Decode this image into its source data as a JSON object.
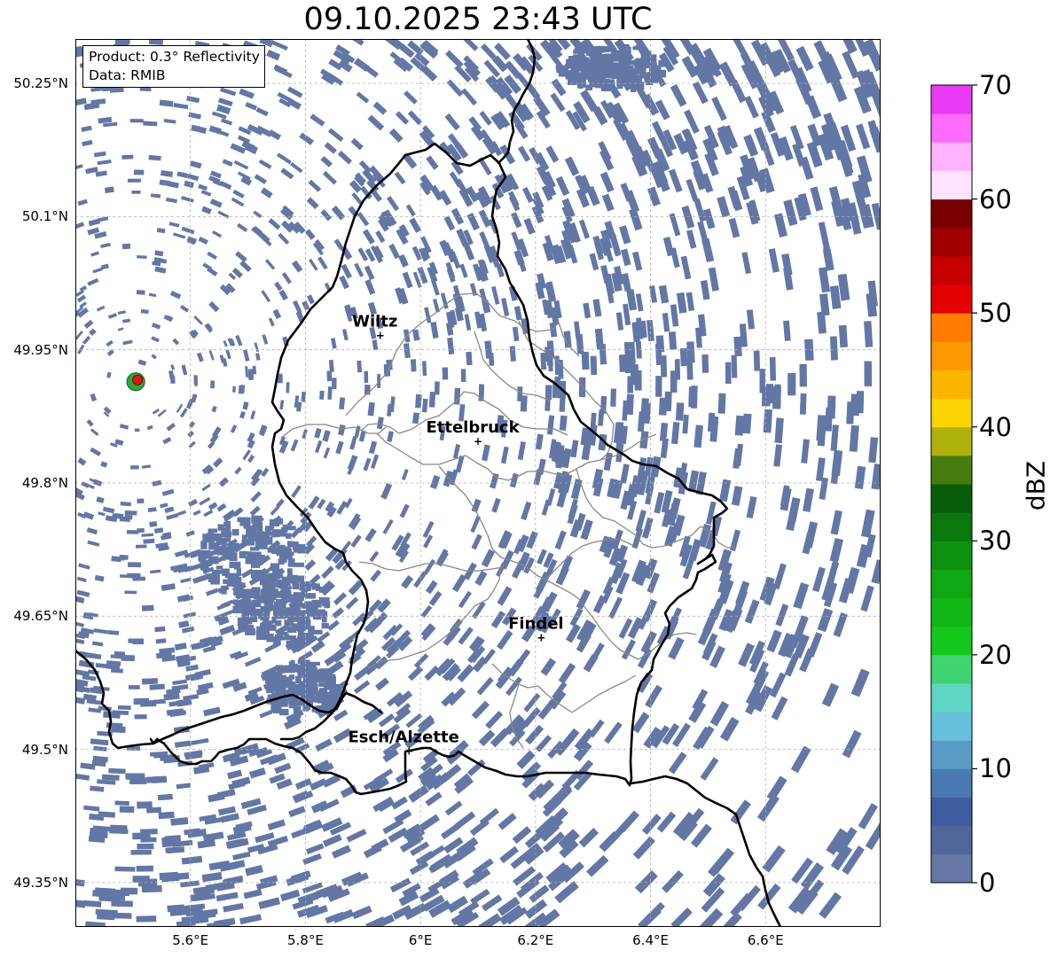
{
  "map": {
    "title": "09.10.2025 23:43 UTC",
    "info": {
      "product": "Product: 0.3° Reflectivity",
      "data": "Data: RMIB"
    },
    "lat_ticks": [
      "50.25°N",
      "50.1°N",
      "49.95°N",
      "49.8°N",
      "49.65°N",
      "49.5°N",
      "49.35°N"
    ],
    "lon_ticks": [
      "5.6°E",
      "5.8°E",
      "6°E",
      "6.2°E",
      "6.4°E",
      "6.6°E"
    ],
    "cities": [
      {
        "name": "Wiltz",
        "lon": 5.93,
        "lat": 49.966
      },
      {
        "name": "Ettelbruck",
        "lon": 6.1,
        "lat": 49.847
      },
      {
        "name": "Findel",
        "lon": 6.21,
        "lat": 49.626
      },
      {
        "name": "Esch/Alzette",
        "lon": 5.98,
        "lat": 49.498
      }
    ],
    "radar_site": {
      "lon": 5.505,
      "lat": 49.914
    },
    "extent": {
      "lon_min": 5.4,
      "lon_max": 6.8,
      "lat_min": 49.3,
      "lat_max": 50.3
    },
    "echo_color": "#6277a5",
    "border_color": "#000000",
    "canton_color": "#888888"
  },
  "colorbar": {
    "label": "dBZ",
    "ticks": [
      "0",
      "10",
      "20",
      "30",
      "40",
      "50",
      "60",
      "70"
    ],
    "range": [
      0,
      70
    ],
    "step": 2.5,
    "colors": [
      "#6577a5",
      "#51679c",
      "#405ca0",
      "#4a7ab3",
      "#5a9cc6",
      "#67c1dc",
      "#5fd5c3",
      "#40d470",
      "#14c71c",
      "#11b716",
      "#0fa713",
      "#0d9210",
      "#0a780c",
      "#075d09",
      "#457d11",
      "#afb00a",
      "#fcd402",
      "#fdb600",
      "#fe9800",
      "#fd7c01",
      "#e40102",
      "#c60000",
      "#a00000",
      "#790000",
      "#fee2fe",
      "#ffb2ff",
      "#fd6cfe",
      "#e93af5"
    ]
  }
}
